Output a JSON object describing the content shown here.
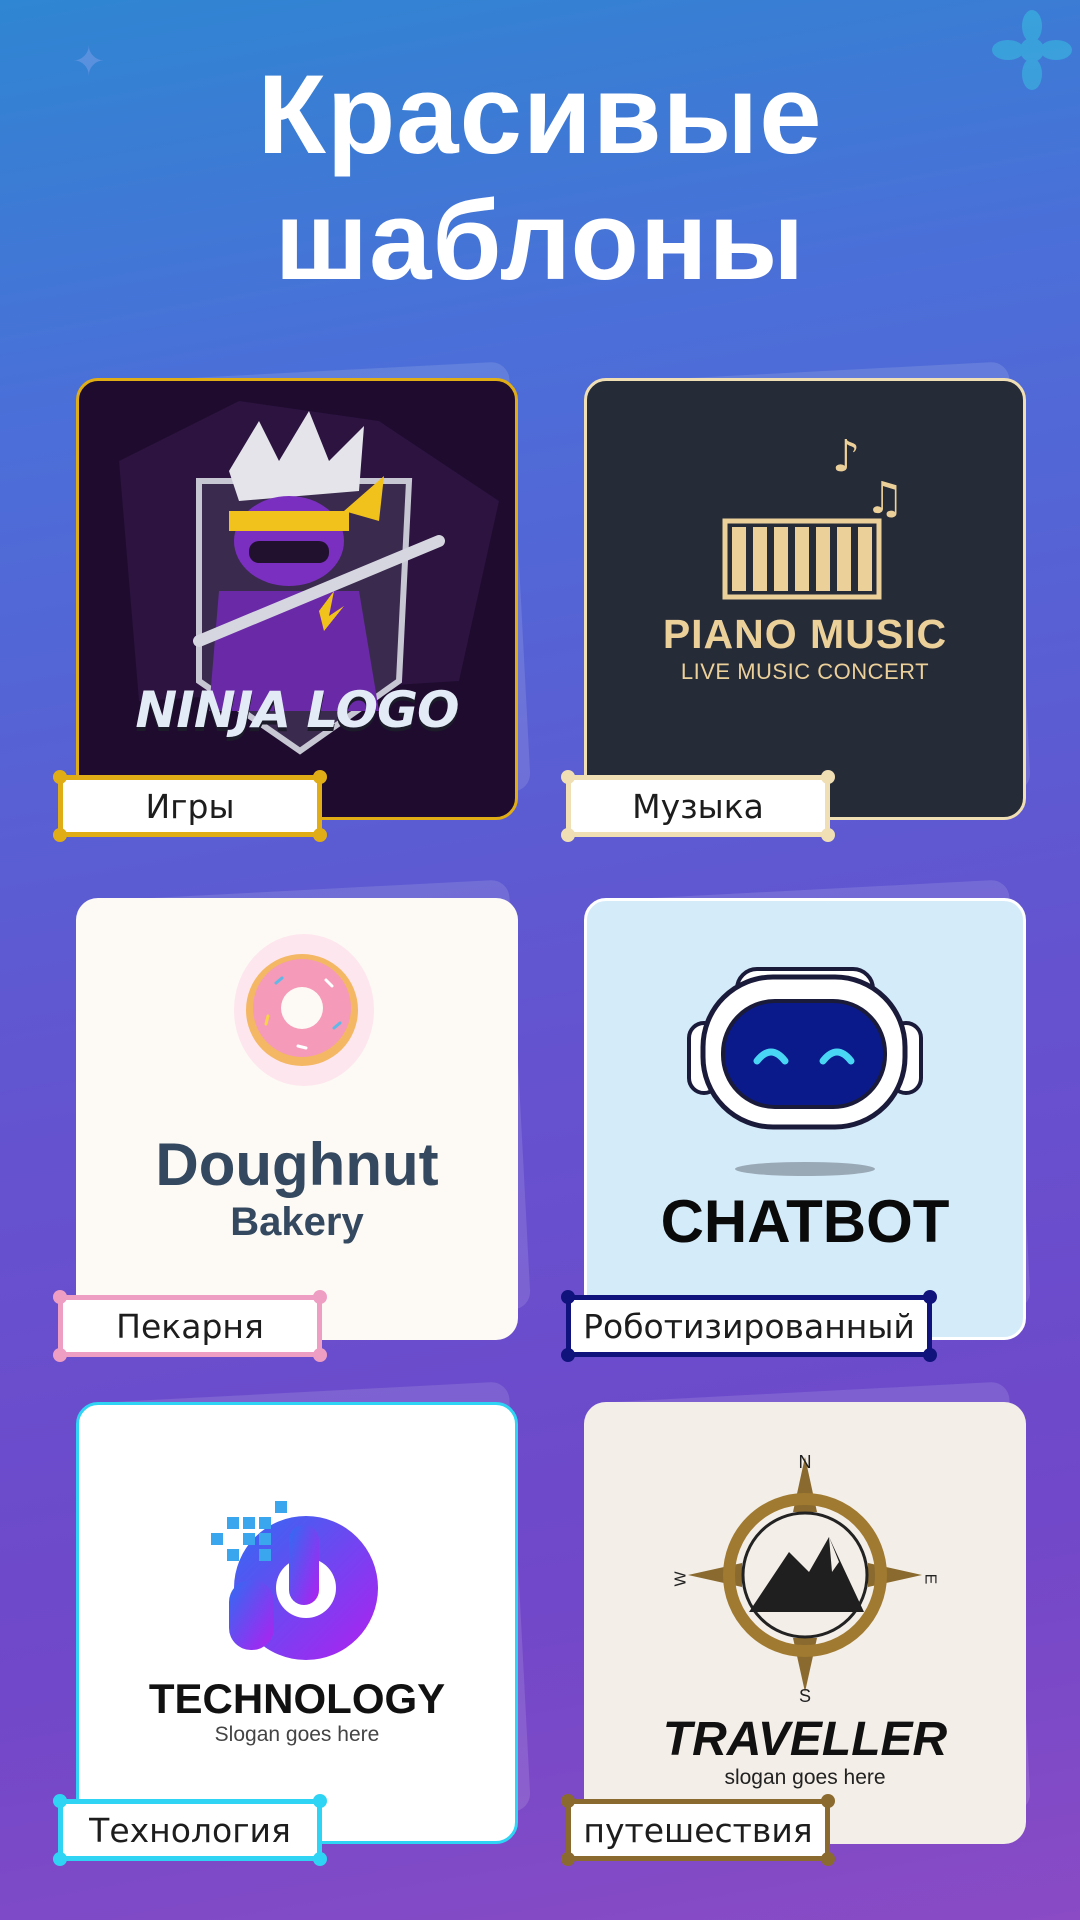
{
  "headline": {
    "line1": "Красивые",
    "line2": "шаблоны"
  },
  "templates": [
    {
      "id": "ninja",
      "category": "Игры",
      "logo_text": "NINJA LOGO",
      "accent": "#e0ad17",
      "bg": "#1e0b2e"
    },
    {
      "id": "piano",
      "category": "Музыка",
      "logo_title": "PIANO MUSIC",
      "logo_subtitle": "LIVE MUSIC CONCERT",
      "accent": "#f0dfb5",
      "bg": "#262b38"
    },
    {
      "id": "bakery",
      "category": "Пекарня",
      "logo_title": "Doughnut",
      "logo_subtitle": "Bakery",
      "accent": "#ef9ec3",
      "bg": "#fdfaf5"
    },
    {
      "id": "chatbot",
      "category": "Роботизированный",
      "logo_title": "CHATBOT",
      "accent": "#10137c",
      "bg": "#d4ebfa"
    },
    {
      "id": "technology",
      "category": "Технология",
      "logo_title": "TECHNOLOGY",
      "logo_subtitle": "Slogan goes here",
      "accent": "#2fd4f4",
      "bg": "#ffffff"
    },
    {
      "id": "traveller",
      "category": "путешествия",
      "logo_title": "TRAVELLER",
      "logo_subtitle": "slogan goes here",
      "compass": {
        "n": "N",
        "s": "S",
        "e": "E",
        "w": "W"
      },
      "accent": "#8a6a2e",
      "bg": "#f3eee7"
    }
  ]
}
